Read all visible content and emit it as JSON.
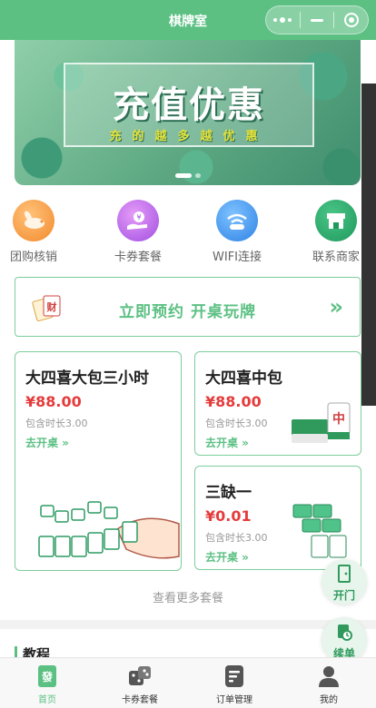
{
  "navbar": {
    "title": "棋牌室"
  },
  "banner": {
    "title": "充值优惠",
    "subtitle": "充的越多越优惠"
  },
  "quick": [
    {
      "label": "团购核销",
      "icon": "rabbit-icon"
    },
    {
      "label": "卡券套餐",
      "icon": "coupon-hand-icon"
    },
    {
      "label": "WIFI连接",
      "icon": "wifi-icon"
    },
    {
      "label": "联系商家",
      "icon": "store-icon"
    }
  ],
  "reserve": {
    "text": "立即预约 开桌玩牌",
    "arrow": "»"
  },
  "packages": [
    {
      "title": "大四喜大包三小时",
      "price": "¥88.00",
      "duration": "包含时长3.00",
      "go": "去开桌 »"
    },
    {
      "title": "大四喜中包",
      "price": "¥88.00",
      "duration": "包含时长3.00",
      "go": "去开桌 »"
    },
    {
      "title": "三缺一",
      "price": "¥0.01",
      "duration": "包含时长3.00",
      "go": "去开桌 »"
    }
  ],
  "more": "查看更多套餐",
  "tutorial": {
    "title": "教程"
  },
  "floats": {
    "open": "开门",
    "renew": "续单"
  },
  "tabs": [
    {
      "label": "首页",
      "icon": "home-icon"
    },
    {
      "label": "卡券套餐",
      "icon": "dice-icon"
    },
    {
      "label": "订单管理",
      "icon": "order-icon"
    },
    {
      "label": "我的",
      "icon": "user-icon"
    }
  ],
  "colors": {
    "brand": "#5cc083",
    "price": "#e53b3b"
  }
}
